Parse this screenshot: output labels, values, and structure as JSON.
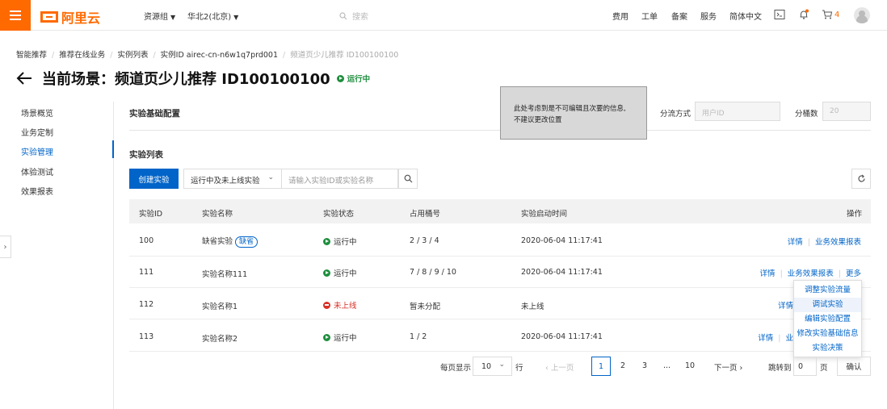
{
  "topbar": {
    "brand": "阿里云",
    "resource_group": "资源组",
    "region": "华北2(北京)",
    "search_placeholder": "搜索",
    "links": [
      "费用",
      "工单",
      "备案",
      "服务",
      "简体中文"
    ],
    "cart_count": "4"
  },
  "breadcrumb": [
    "智能推荐",
    "推荐在线业务",
    "实例列表",
    "实例ID airec-cn-n6w1q7prd001",
    "频道页少儿推荐 ID100100100"
  ],
  "page": {
    "title": "当前场景：频道页少儿推荐 ID100100100",
    "status": "运行中"
  },
  "sidenav": {
    "items": [
      "场景概览",
      "业务定制",
      "实验管理",
      "体验测试",
      "效果报表"
    ],
    "active_index": 2
  },
  "config": {
    "title": "实验基础配置",
    "tooltip_line1": "此处考虑到是不可编辑且次要的信息,",
    "tooltip_line2": "不建议更改位置",
    "split_label": "分流方式",
    "split_value": "用户ID",
    "buckets_label": "分桶数",
    "buckets_value": "20"
  },
  "list": {
    "title": "实验列表",
    "create_button": "创建实验",
    "filter_value": "运行中及未上线实验",
    "search_placeholder": "请输入实验ID或实验名称"
  },
  "table": {
    "headers": [
      "实验ID",
      "实验名称",
      "实验状态",
      "占用桶号",
      "实验启动时间",
      "操作"
    ],
    "rows": [
      {
        "id": "100",
        "name": "缺省实验",
        "tag": "缺省",
        "status": "运行中",
        "buckets": "2 / 3 / 4",
        "time": "2020-06-04 11:17:41",
        "ops": [
          "详情",
          "业务效果报表"
        ]
      },
      {
        "id": "111",
        "name": "实验名称111",
        "status": "运行中",
        "buckets": "7 / 8 / 9 / 10",
        "time": "2020-06-04 11:17:41",
        "ops": [
          "详情",
          "业务效果报表",
          "更多"
        ]
      },
      {
        "id": "112",
        "name": "实验名称1",
        "status": "未上线",
        "buckets": "暂未分配",
        "time": "未上线",
        "ops": [
          "详情"
        ]
      },
      {
        "id": "113",
        "name": "实验名称2",
        "status": "运行中",
        "buckets": "1 / 2",
        "time": "2020-06-04 11:17:41",
        "ops": [
          "详情",
          "业"
        ]
      }
    ]
  },
  "more_menu": [
    "调整实验流量",
    "调试实验",
    "编辑实验配置",
    "修改实验基础信息",
    "实验决策"
  ],
  "pagination": {
    "per_page_label": "每页显示",
    "per_page_value": "10",
    "row_unit": "行",
    "prev": "上一页",
    "pages": [
      "1",
      "2",
      "3",
      "...",
      "10"
    ],
    "current": "1",
    "next": "下一页",
    "jump_label": "跳转到",
    "jump_value": "0",
    "page_unit": "页",
    "confirm": "确认"
  },
  "colors": {
    "brand": "#ff6a00",
    "primary": "#0064c8",
    "running": "#1e8e3e",
    "offline": "#d93026"
  }
}
